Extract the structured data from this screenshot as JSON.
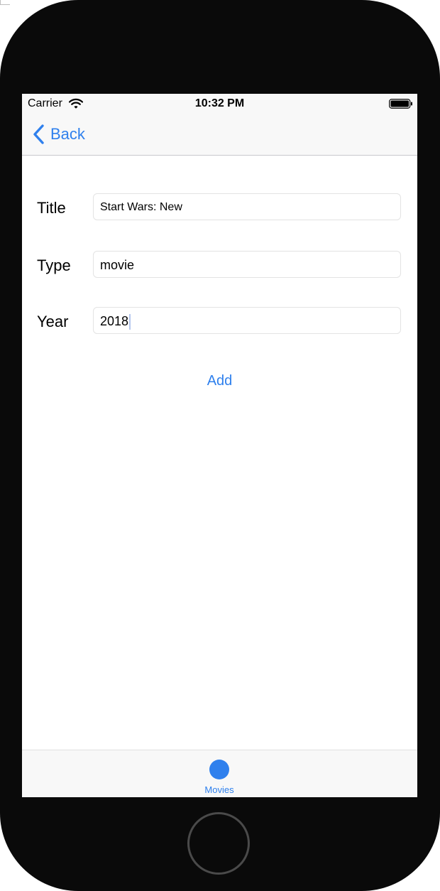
{
  "status_bar": {
    "carrier": "Carrier",
    "time": "10:32 PM",
    "wifi_icon": "wifi-icon",
    "battery_icon": "battery-icon"
  },
  "nav_bar": {
    "back_label": "Back",
    "back_icon": "chevron-left-icon"
  },
  "form": {
    "title_label": "Title",
    "title_value": "Start Wars: New",
    "type_label": "Type",
    "type_value": "movie",
    "year_label": "Year",
    "year_value": "2018"
  },
  "add_label": "Add",
  "tab_bar": {
    "items": [
      {
        "label": "Movies",
        "icon": "circle-icon",
        "selected": true
      }
    ]
  },
  "colors": {
    "accent": "#2f80ed",
    "device_frame": "#0a0a0a",
    "bar_background": "#f8f8f8"
  }
}
